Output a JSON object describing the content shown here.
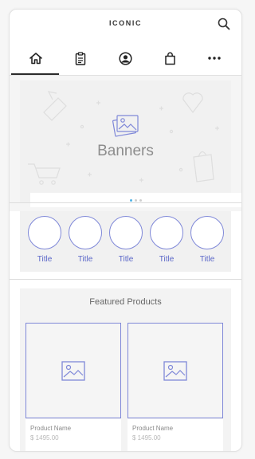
{
  "app": {
    "brand": "ICONIC"
  },
  "header": {
    "search_icon": "search-icon"
  },
  "tabs": [
    {
      "icon": "home-icon",
      "active": true
    },
    {
      "icon": "clipboard-icon",
      "active": false
    },
    {
      "icon": "account-icon",
      "active": false
    },
    {
      "icon": "shopping-bag-icon",
      "active": false
    },
    {
      "icon": "more-icon",
      "active": false
    }
  ],
  "banner": {
    "label": "Banners",
    "dots": 3,
    "active_dot": 0
  },
  "categories": [
    {
      "label": "Title"
    },
    {
      "label": "Title"
    },
    {
      "label": "Title"
    },
    {
      "label": "Title"
    },
    {
      "label": "Title"
    }
  ],
  "featured": {
    "title": "Featured Products",
    "products": [
      {
        "name": "Product Name",
        "price": "$ 1495.00"
      },
      {
        "name": "Product Name",
        "price": "$ 1495.00"
      }
    ]
  },
  "colors": {
    "accent": "#7f88d8",
    "active_dot": "#52b3e6",
    "tab_indicator": "#2b2b2b"
  }
}
